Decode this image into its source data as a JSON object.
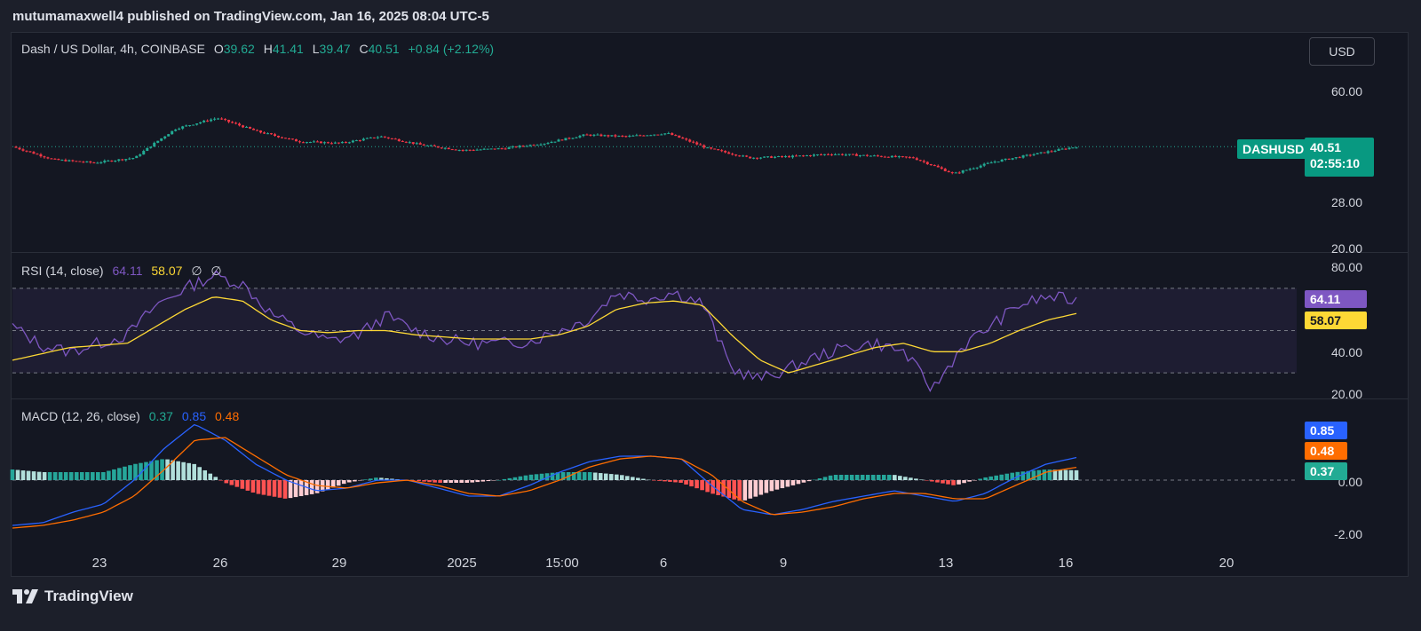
{
  "header": {
    "publish_text": "mutumamaxwell4 published on TradingView.com, Jan 16, 2025 08:04 UTC-5"
  },
  "price_legend": {
    "symbol": "Dash / US Dollar, 4h, COINBASE",
    "o_label": "O",
    "o_value": "39.62",
    "h_label": "H",
    "h_value": "41.41",
    "l_label": "L",
    "l_value": "39.47",
    "c_label": "C",
    "c_value": "40.51",
    "change": "+0.84 (+2.12%)"
  },
  "currency_button": "USD",
  "price_tag": {
    "symbol": "DASHUSD",
    "price": "40.51",
    "countdown": "02:55:10"
  },
  "rsi_legend": {
    "name": "RSI (14, close)",
    "rsi": "64.11",
    "ma": "58.07",
    "x1": "∅",
    "x2": "∅"
  },
  "macd_legend": {
    "name": "MACD (12, 26, close)",
    "hist": "0.37",
    "macd": "0.85",
    "signal": "0.48"
  },
  "footer": {
    "brand": "TradingView"
  },
  "colors": {
    "up": "#22ab94",
    "down": "#f23645",
    "rsi_line": "#7e57c2",
    "rsi_ma": "#fdd835",
    "macd_line": "#2962ff",
    "signal_line": "#ff6d00",
    "hist_up_strong": "#26a69a",
    "hist_up_weak": "#b2dfdb",
    "hist_down_strong": "#ff5252",
    "hist_down_weak": "#ffcdd2"
  },
  "chart_data": [
    {
      "type": "candlestick",
      "title": "Dash / US Dollar, 4h, COINBASE",
      "y_ticks": [
        "60.00",
        "28.00",
        "20.00"
      ],
      "x_ticks": [
        "23",
        "26",
        "29",
        "2025",
        "15:00",
        "6",
        "9",
        "13",
        "16",
        "20"
      ],
      "y_scale": "log",
      "ylim": [
        20,
        68
      ],
      "close_path": [
        {
          "x": "20",
          "y": 40.5
        },
        {
          "x": "21",
          "y": 37.0
        },
        {
          "x": "22",
          "y": 36.2
        },
        {
          "x": "23",
          "y": 37.5
        },
        {
          "x": "24",
          "y": 46.0
        },
        {
          "x": "25",
          "y": 49.5
        },
        {
          "x": "26",
          "y": 45.0
        },
        {
          "x": "27",
          "y": 42.0
        },
        {
          "x": "28",
          "y": 41.5
        },
        {
          "x": "29",
          "y": 43.5
        },
        {
          "x": "30",
          "y": 41.0
        },
        {
          "x": "31",
          "y": 39.5
        },
        {
          "x": "2025",
          "y": 40.0
        },
        {
          "x": "2",
          "y": 41.5
        },
        {
          "x": "15:00",
          "y": 44.0
        },
        {
          "x": "5",
          "y": 43.5
        },
        {
          "x": "6",
          "y": 44.5
        },
        {
          "x": "7",
          "y": 40.0
        },
        {
          "x": "8",
          "y": 37.5
        },
        {
          "x": "9",
          "y": 37.8
        },
        {
          "x": "10",
          "y": 38.5
        },
        {
          "x": "11",
          "y": 38.0
        },
        {
          "x": "12",
          "y": 37.5
        },
        {
          "x": "13",
          "y": 33.5
        },
        {
          "x": "14",
          "y": 36.5
        },
        {
          "x": "15",
          "y": 38.5
        },
        {
          "x": "16",
          "y": 40.51
        }
      ],
      "last_price": 40.51
    },
    {
      "type": "line",
      "title": "RSI (14, close)",
      "y_ticks": [
        "80.00",
        "40.00",
        "20.00"
      ],
      "ylim": [
        20,
        80
      ],
      "bands": [
        70,
        50,
        30
      ],
      "series": [
        {
          "name": "RSI",
          "values": [
            52,
            43,
            40,
            44,
            48,
            62,
            70,
            76,
            72,
            58,
            50,
            45,
            48,
            57,
            50,
            46,
            44,
            44,
            45,
            50,
            55,
            68,
            65,
            68,
            63,
            32,
            27,
            32,
            38,
            42,
            44,
            40,
            22,
            42,
            52,
            62,
            66,
            64.11
          ]
        },
        {
          "name": "RSI MA",
          "values": [
            36,
            39,
            42,
            43,
            44,
            52,
            60,
            66,
            64,
            55,
            50,
            49,
            50,
            50,
            48,
            47,
            46,
            46,
            46,
            48,
            52,
            60,
            63,
            64,
            62,
            48,
            36,
            30,
            34,
            38,
            42,
            44,
            40,
            40,
            44,
            50,
            55,
            58.07
          ]
        }
      ]
    },
    {
      "type": "bar",
      "title": "MACD (12, 26, close)",
      "y_ticks": [
        "0.00",
        "-2.00"
      ],
      "ylim": [
        -2.6,
        2.3
      ],
      "series": [
        {
          "name": "MACD",
          "values": [
            -1.7,
            -1.6,
            -1.2,
            -0.9,
            0.0,
            1.2,
            2.1,
            1.5,
            0.6,
            0.0,
            -0.4,
            -0.3,
            0.0,
            0.0,
            -0.3,
            -0.6,
            -0.6,
            -0.2,
            0.3,
            0.7,
            0.9,
            0.9,
            0.8,
            -0.2,
            -1.1,
            -1.3,
            -1.1,
            -0.8,
            -0.6,
            -0.4,
            -0.6,
            -0.8,
            -0.5,
            0.1,
            0.6,
            0.85
          ]
        },
        {
          "name": "Signal",
          "values": [
            -1.8,
            -1.7,
            -1.5,
            -1.2,
            -0.6,
            0.4,
            1.5,
            1.6,
            0.9,
            0.2,
            -0.2,
            -0.3,
            -0.1,
            0.0,
            -0.2,
            -0.5,
            -0.6,
            -0.4,
            0.0,
            0.5,
            0.8,
            0.9,
            0.8,
            0.2,
            -0.8,
            -1.3,
            -1.2,
            -1.0,
            -0.7,
            -0.5,
            -0.5,
            -0.7,
            -0.7,
            -0.2,
            0.3,
            0.48
          ]
        },
        {
          "name": "Histogram",
          "values": [
            0.4,
            0.3,
            0.3,
            0.3,
            0.6,
            0.8,
            0.6,
            -0.1,
            -0.5,
            -0.7,
            -0.5,
            -0.1,
            0.1,
            0.0,
            -0.1,
            -0.1,
            0.0,
            0.2,
            0.3,
            0.3,
            0.2,
            0.0,
            -0.1,
            -0.5,
            -0.8,
            -0.4,
            -0.1,
            0.2,
            0.2,
            0.2,
            0.0,
            -0.2,
            0.1,
            0.3,
            0.4,
            0.37
          ]
        }
      ]
    }
  ]
}
